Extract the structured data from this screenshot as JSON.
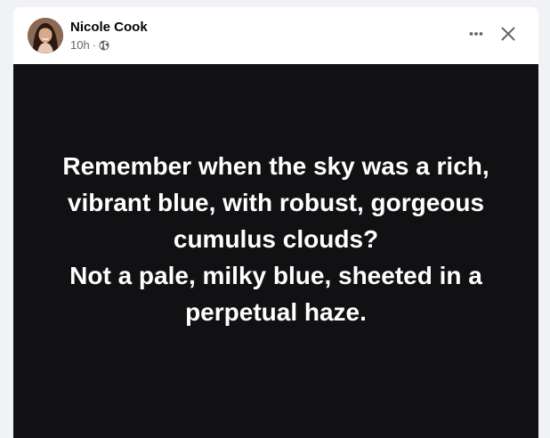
{
  "post": {
    "author": "Nicole Cook",
    "time": "10h",
    "separator": "·",
    "audience_icon": "globe-icon",
    "body_text": "Remember when the sky was a rich,\nvibrant blue, with robust, gorgeous\ncumulus clouds?\nNot a pale, milky blue, sheeted in a\nperpetual haze.",
    "background_color": "#111113",
    "text_color": "#ffffff"
  },
  "header": {
    "more_icon": "more-options-icon",
    "close_icon": "close-icon"
  }
}
